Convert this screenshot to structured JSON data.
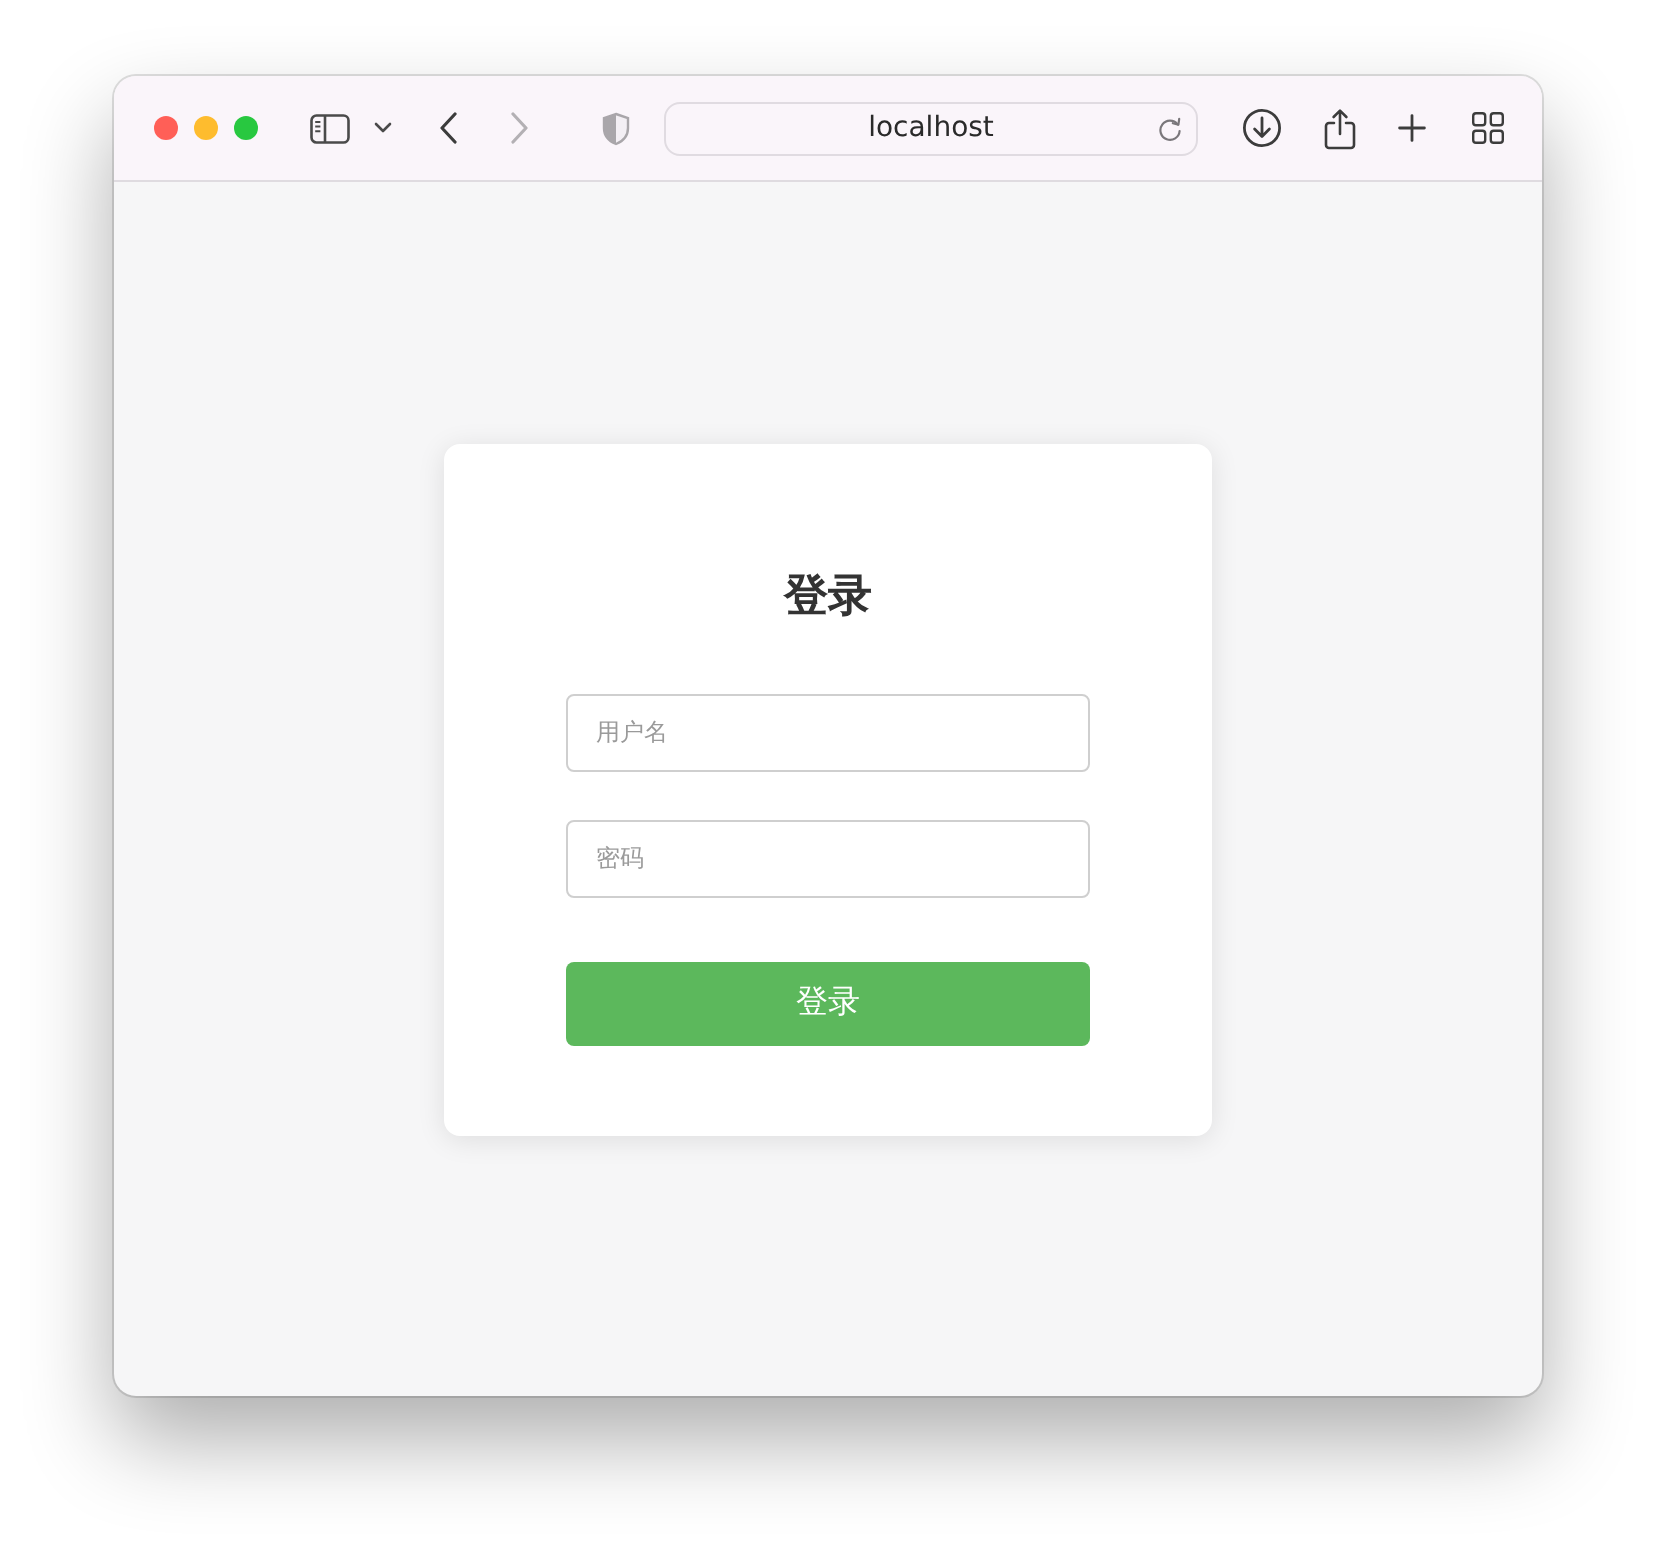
{
  "browser": {
    "navigation": [
      {
        "kind": "back",
        "disabled": false
      },
      {
        "kind": "forward",
        "disabled": true
      }
    ],
    "address": "localhost"
  },
  "login": {
    "title": "登录",
    "fields": [
      {
        "placeholder": "用户名"
      },
      {
        "placeholder": "密码"
      }
    ],
    "submit_button": "登录"
  }
}
